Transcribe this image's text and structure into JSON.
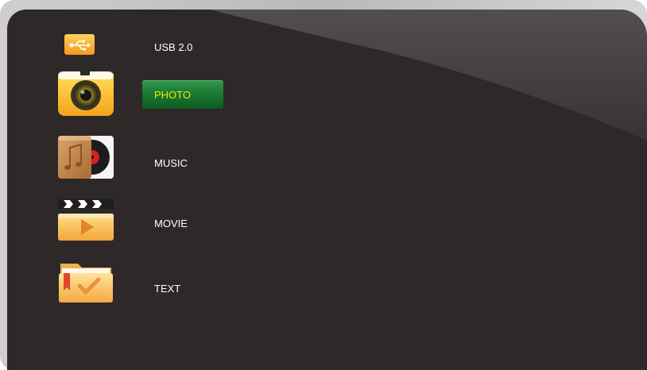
{
  "source": {
    "label": "USB 2.0",
    "icon": "usb-icon"
  },
  "menu": {
    "items": [
      {
        "id": "photo",
        "label": "PHOTO",
        "icon": "camera-icon",
        "selected": true
      },
      {
        "id": "music",
        "label": "MUSIC",
        "icon": "music-record-icon",
        "selected": false
      },
      {
        "id": "movie",
        "label": "MOVIE",
        "icon": "clapperboard-icon",
        "selected": false
      },
      {
        "id": "text",
        "label": "TEXT",
        "icon": "folder-check-icon",
        "selected": false
      }
    ]
  },
  "colors": {
    "panel_bg": "#2e2828",
    "highlight": "#1b7a34",
    "selected_text": "#f2e800",
    "text": "#ffffff",
    "icon_orange": "#f6b43c"
  }
}
